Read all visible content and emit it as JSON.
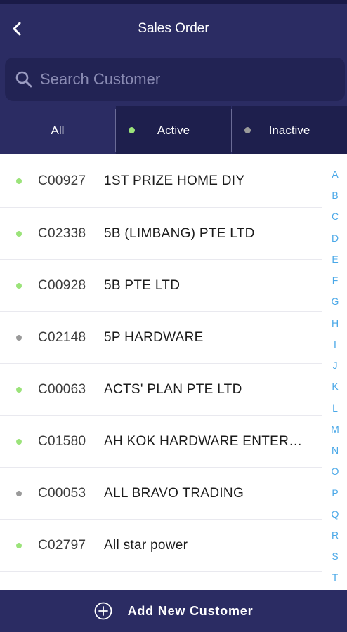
{
  "header": {
    "title": "Sales Order",
    "back_icon": "chevron-left-icon"
  },
  "search": {
    "placeholder": "Search Customer",
    "value": "",
    "icon": "search-icon"
  },
  "tabs": [
    {
      "label": "All",
      "selected": true,
      "dot_color": null
    },
    {
      "label": "Active",
      "selected": false,
      "dot_color": "#9be37a"
    },
    {
      "label": "Inactive",
      "selected": false,
      "dot_color": "#9a9a9a"
    }
  ],
  "customers": [
    {
      "code": "C00927",
      "name": "1ST PRIZE HOME DIY",
      "status": "active"
    },
    {
      "code": "C02338",
      "name": "5B (LIMBANG) PTE LTD",
      "status": "active"
    },
    {
      "code": "C00928",
      "name": "5B PTE LTD",
      "status": "active"
    },
    {
      "code": "C02148",
      "name": "5P HARDWARE",
      "status": "inactive"
    },
    {
      "code": "C00063",
      "name": "ACTS' PLAN PTE LTD",
      "status": "active"
    },
    {
      "code": "C01580",
      "name": "AH KOK HARDWARE ENTER…",
      "status": "active"
    },
    {
      "code": "C00053",
      "name": "ALL BRAVO TRADING",
      "status": "inactive"
    },
    {
      "code": "C02797",
      "name": "All star power",
      "status": "active"
    }
  ],
  "alphabet_index": [
    "A",
    "B",
    "C",
    "D",
    "E",
    "F",
    "G",
    "H",
    "I",
    "J",
    "K",
    "L",
    "M",
    "N",
    "O",
    "P",
    "Q",
    "R",
    "S",
    "T"
  ],
  "footer": {
    "add_label": "Add New Customer",
    "icon": "plus-circle-icon"
  },
  "colors": {
    "header_bg": "#2b2c63",
    "search_bg": "#222354",
    "active_dot": "#9be37a",
    "inactive_dot": "#9a9a9a",
    "index_letter": "#4aa8e8"
  }
}
